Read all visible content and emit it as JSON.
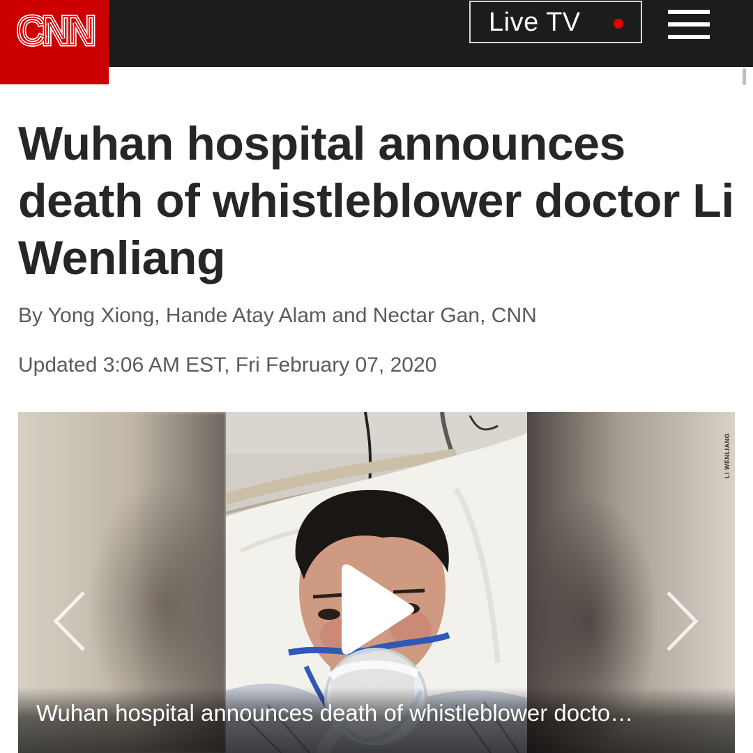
{
  "header": {
    "logo_text": "CNN",
    "live_tv_label": "Live TV",
    "colors": {
      "bar": "#1c1c1c",
      "logo": "#cc0000",
      "live_dot": "#e20000"
    },
    "menu_icon": "hamburger-menu-icon"
  },
  "article": {
    "headline": "Wuhan hospital announces death of whistleblower doctor Li Wenliang",
    "byline": "By Yong Xiong, Hande Atay Alam and Nectar Gan, CNN",
    "updated": "Updated 3:06 AM EST, Fri February 07, 2020"
  },
  "media": {
    "photo_credit": "LI WENLIANG",
    "caption": "Wuhan hospital announces death of whistleblower docto…",
    "icons": {
      "play": "play-icon",
      "previous": "chevron-left-icon",
      "next": "chevron-right-icon"
    }
  }
}
